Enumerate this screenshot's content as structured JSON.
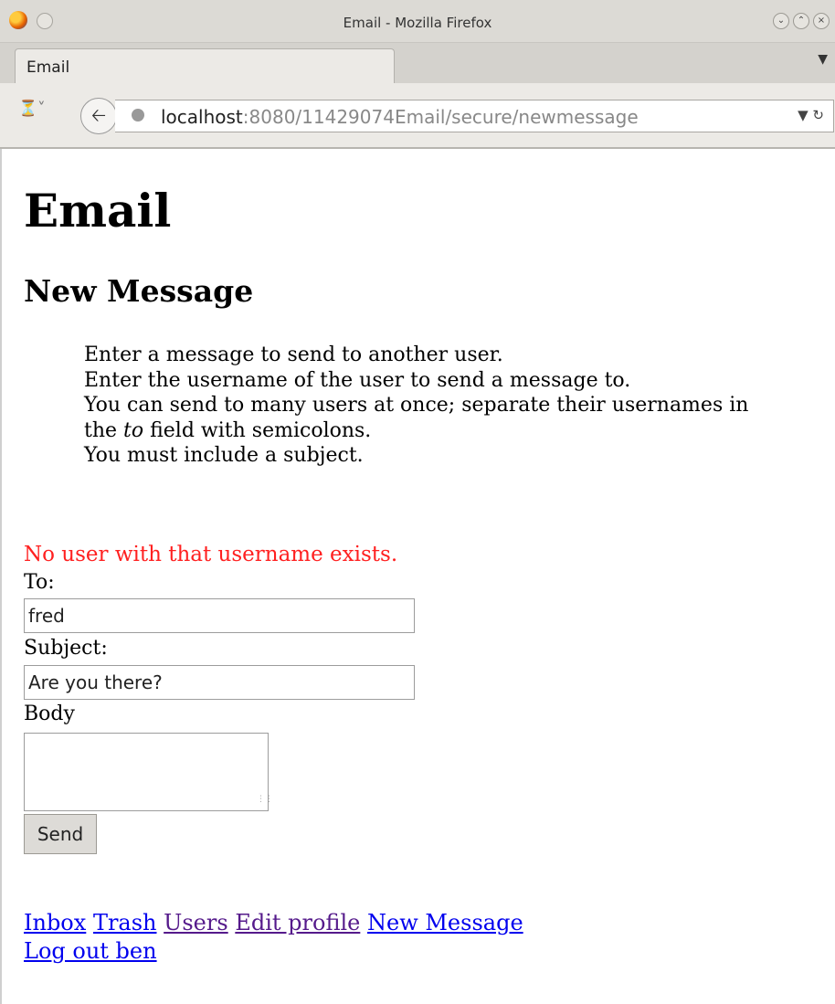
{
  "window": {
    "title": "Email - Mozilla Firefox"
  },
  "tab": {
    "label": "Email"
  },
  "urlbar": {
    "host": "localhost",
    "rest": ":8080/11429074Email/secure/newmessage"
  },
  "page": {
    "heading": "Email",
    "subheading": "New Message",
    "intro": {
      "line1": "Enter a message to send to another user.",
      "line2": "Enter the username of the user to send a message to.",
      "line3_before": "You can send to many users at once; separate their usernames in the ",
      "line3_em": "to",
      "line3_after": " field with semicolons.",
      "line4": "You must include a subject."
    },
    "error": "No user with that username exists.",
    "form": {
      "to_label": "To:",
      "to_value": "fred",
      "subject_label": "Subject:",
      "subject_value": "Are you there?",
      "body_label": "Body",
      "body_value": "",
      "send_label": "Send"
    },
    "nav": {
      "inbox": "Inbox",
      "trash": "Trash",
      "users": "Users",
      "edit_profile": "Edit profile",
      "new_message": "New Message",
      "logout": "Log out ben"
    }
  },
  "colors": {
    "error": "#ff2020",
    "link": "#0000ee",
    "visited_link": "#551a8b"
  }
}
